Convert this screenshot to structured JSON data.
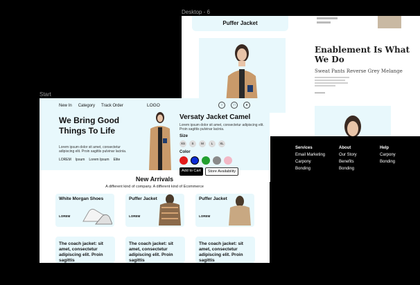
{
  "labels": {
    "back": "Desktop - 6",
    "front": "Start"
  },
  "back_frame": {
    "card_title": "Puffer Jacket",
    "headline": "Enablement Is What We Do",
    "subline": "Sweat Pants Reverse Grey Melange",
    "footer": [
      {
        "heading": "Services",
        "items": [
          "Email Marketing",
          "Carpony",
          "Bonding"
        ]
      },
      {
        "heading": "About",
        "items": [
          "Our Story",
          "Benefits",
          "Bonding"
        ]
      },
      {
        "heading": "Help",
        "items": [
          "Carpony",
          "Bonding"
        ]
      }
    ]
  },
  "front_frame": {
    "nav": [
      "New In",
      "Category",
      "Track Order"
    ],
    "logo": "LOGO",
    "hero": {
      "title": "We Bring Good Things To Life",
      "desc": "Lorem ipsum dolor sit amet, consectetur adipiscing elit. Proin sagittis pulvinar lacinia.",
      "links": [
        "LOREM",
        "Ipsum",
        "Lorem Ipsum",
        "Elite"
      ]
    },
    "product": {
      "title": "Versaty Jacket Camel",
      "desc": "Lorem ipsum dolor sit amet, consectetur adipiscing elit. Proin sagittis pulvinar lacinia.",
      "size_label": "Size",
      "sizes": [
        "XS",
        "S",
        "M",
        "L",
        "XL"
      ],
      "color_label": "Color",
      "colors": [
        "#e11b1b",
        "#0a2bd6",
        "#22a02f",
        "#8a8a8a",
        "#f2b8c6"
      ],
      "add_to_cart": "Add to Cart",
      "store_availability": "Store Availability"
    },
    "new_arrivals": {
      "title": "New Arrivals",
      "subtitle": "A different kind of company. A different kind of Ecommerce"
    },
    "cards": [
      {
        "title": "White Morgan Shoes",
        "lorem": "LOREM"
      },
      {
        "title": "Puffer Jacket",
        "lorem": "LOREM"
      },
      {
        "title": "Puffer Jacket",
        "lorem": "LOREM"
      }
    ],
    "promos": [
      "The coach jacket: sit amet, consectetur adipiscing elit. Proin sagittis",
      "The coach jacket: sit amet, consectetur adipiscing elit. Proin sagittis",
      "The coach jacket: sit amet, consectetur adipiscing elit. Proin sagittis"
    ]
  }
}
